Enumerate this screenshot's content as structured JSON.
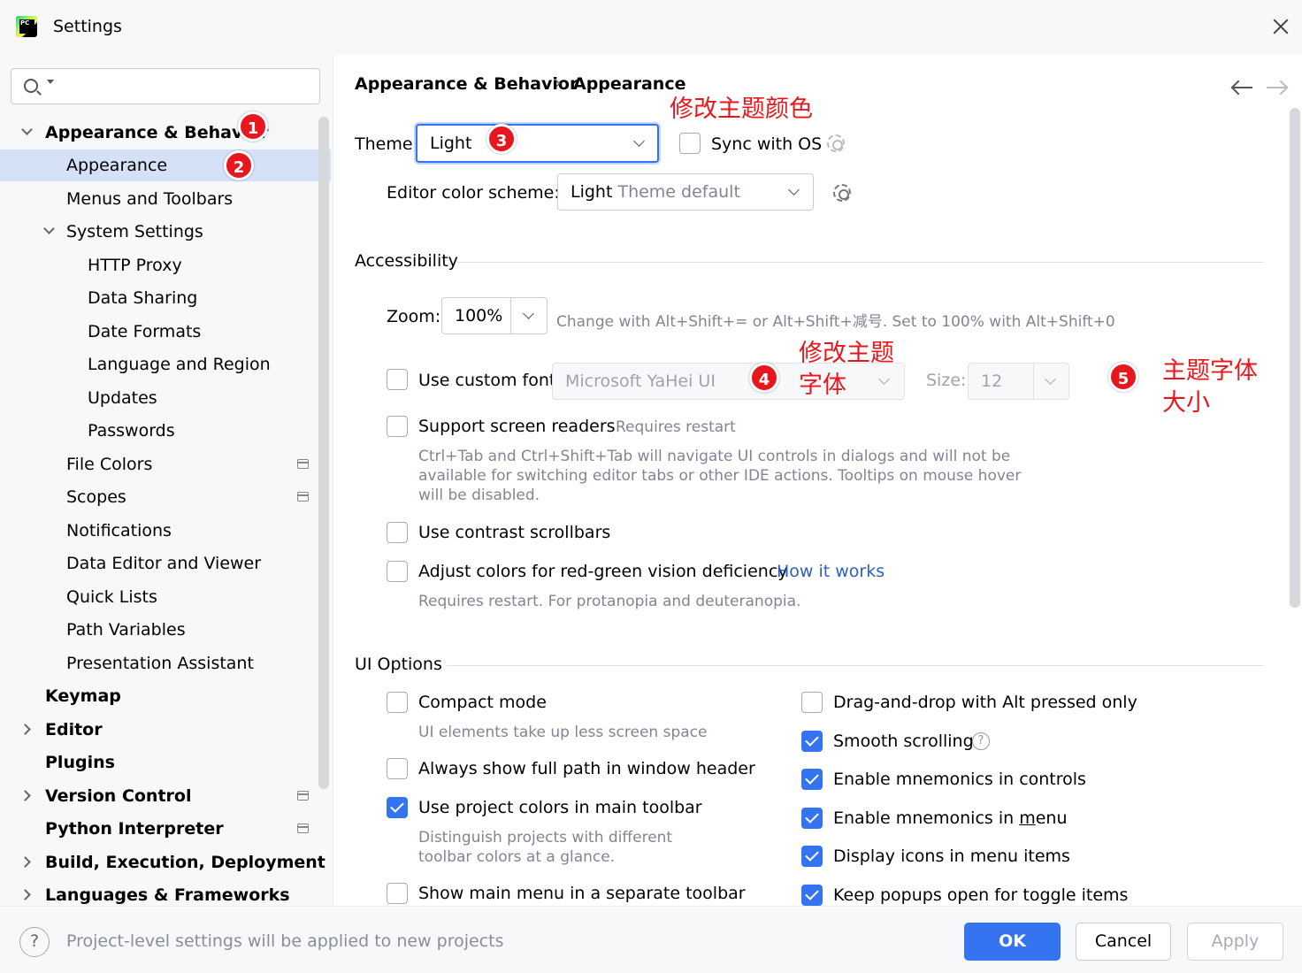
{
  "window": {
    "title": "Settings"
  },
  "search": {
    "placeholder": ""
  },
  "tree": [
    {
      "label": "Appearance & Behavior",
      "bold": true,
      "expander": "down",
      "selected": false
    },
    {
      "label": "Appearance",
      "bold": false,
      "expander": "",
      "selected": true
    },
    {
      "label": "Menus and Toolbars",
      "bold": false,
      "expander": "",
      "selected": false
    },
    {
      "label": "System Settings",
      "bold": false,
      "expander": "down",
      "selected": false
    },
    {
      "label": "HTTP Proxy",
      "bold": false,
      "expander": "",
      "selected": false
    },
    {
      "label": "Data Sharing",
      "bold": false,
      "expander": "",
      "selected": false
    },
    {
      "label": "Date Formats",
      "bold": false,
      "expander": "",
      "selected": false
    },
    {
      "label": "Language and Region",
      "bold": false,
      "expander": "",
      "selected": false
    },
    {
      "label": "Updates",
      "bold": false,
      "expander": "",
      "selected": false
    },
    {
      "label": "Passwords",
      "bold": false,
      "expander": "",
      "selected": false
    },
    {
      "label": "File Colors",
      "bold": false,
      "expander": "",
      "selected": false,
      "project_icon": true
    },
    {
      "label": "Scopes",
      "bold": false,
      "expander": "",
      "selected": false,
      "project_icon": true
    },
    {
      "label": "Notifications",
      "bold": false,
      "expander": "",
      "selected": false
    },
    {
      "label": "Data Editor and Viewer",
      "bold": false,
      "expander": "",
      "selected": false
    },
    {
      "label": "Quick Lists",
      "bold": false,
      "expander": "",
      "selected": false
    },
    {
      "label": "Path Variables",
      "bold": false,
      "expander": "",
      "selected": false
    },
    {
      "label": "Presentation Assistant",
      "bold": false,
      "expander": "",
      "selected": false
    },
    {
      "label": "Keymap",
      "bold": true,
      "expander": "",
      "selected": false
    },
    {
      "label": "Editor",
      "bold": true,
      "expander": "right",
      "selected": false
    },
    {
      "label": "Plugins",
      "bold": true,
      "expander": "",
      "selected": false
    },
    {
      "label": "Version Control",
      "bold": true,
      "expander": "right",
      "selected": false,
      "project_icon": true
    },
    {
      "label": "Python Interpreter",
      "bold": true,
      "expander": "",
      "selected": false,
      "project_icon": true
    },
    {
      "label": "Build, Execution, Deployment",
      "bold": true,
      "expander": "right",
      "selected": false
    },
    {
      "label": "Languages & Frameworks",
      "bold": true,
      "expander": "right",
      "selected": false
    }
  ],
  "badges": [
    "1",
    "2",
    "3",
    "4",
    "5"
  ],
  "breadcrumb": {
    "parent": "Appearance & Behavior",
    "separator": "›",
    "current": "Appearance"
  },
  "theme": {
    "label": "Theme:",
    "value": "Light",
    "sync_label": "Sync with OS",
    "sync_checked": false
  },
  "editor_scheme": {
    "label": "Editor color scheme:",
    "value_main": "Light",
    "value_suffix": " Theme default"
  },
  "accessibility": {
    "title": "Accessibility",
    "zoom_label": "Zoom:",
    "zoom_value": "100%",
    "zoom_hint": "Change with Alt+Shift+= or Alt+Shift+减号. Set to 100% with Alt+Shift+0",
    "custom_font_label": "Use custom font:",
    "custom_font_checked": false,
    "font_value": "Microsoft YaHei UI",
    "size_label": "Size:",
    "size_value": "12",
    "screen_readers_label": "Support screen readers",
    "screen_readers_hint": "Requires restart",
    "screen_readers_desc": [
      "Ctrl+Tab and Ctrl+Shift+Tab will navigate UI controls in dialogs and will not be",
      "available for switching editor tabs or other IDE actions. Tooltips on mouse hover",
      "will be disabled."
    ],
    "contrast_label": "Use contrast scrollbars",
    "colorblind_label": "Adjust colors for red-green vision deficiency",
    "how_it_works": "How it works",
    "colorblind_hint": "Requires restart. For protanopia and deuteranopia."
  },
  "ui_options": {
    "title": "UI Options",
    "left": [
      {
        "label": "Compact mode",
        "checked": false,
        "hint": "UI elements take up less screen space"
      },
      {
        "label": "Always show full path in window header",
        "checked": false
      },
      {
        "label": "Use project colors in main toolbar",
        "checked": true,
        "hint_lines": [
          "Distinguish projects with different",
          "toolbar colors at a glance."
        ]
      },
      {
        "label": "Show main menu in a separate toolbar",
        "checked": false
      }
    ],
    "right": [
      {
        "label": "Drag-and-drop with Alt pressed only",
        "checked": false
      },
      {
        "label": "Smooth scrolling",
        "checked": true
      },
      {
        "label": "Enable mnemonics in controls",
        "checked": true
      },
      {
        "label_pre": "Enable mnemonics in ",
        "label_mnemonic": "m",
        "label_post": "enu",
        "checked": true
      },
      {
        "label": "Display icons in menu items",
        "checked": true
      },
      {
        "label": "Keep popups open for toggle items",
        "checked": true
      }
    ]
  },
  "annotations": {
    "theme_color": "修改主题颜色",
    "theme_font": [
      "修改主题",
      "字体"
    ],
    "font_size": [
      "主题字体",
      "大小"
    ]
  },
  "footer": {
    "help": "?",
    "text": "Project-level settings will be applied to new projects",
    "ok": "OK",
    "cancel": "Cancel",
    "apply": "Apply"
  },
  "colors": {
    "accent": "#3574f0",
    "selection": "#d5e1f7",
    "annotation_red": "#e8161d",
    "link": "#2c5fbf"
  }
}
